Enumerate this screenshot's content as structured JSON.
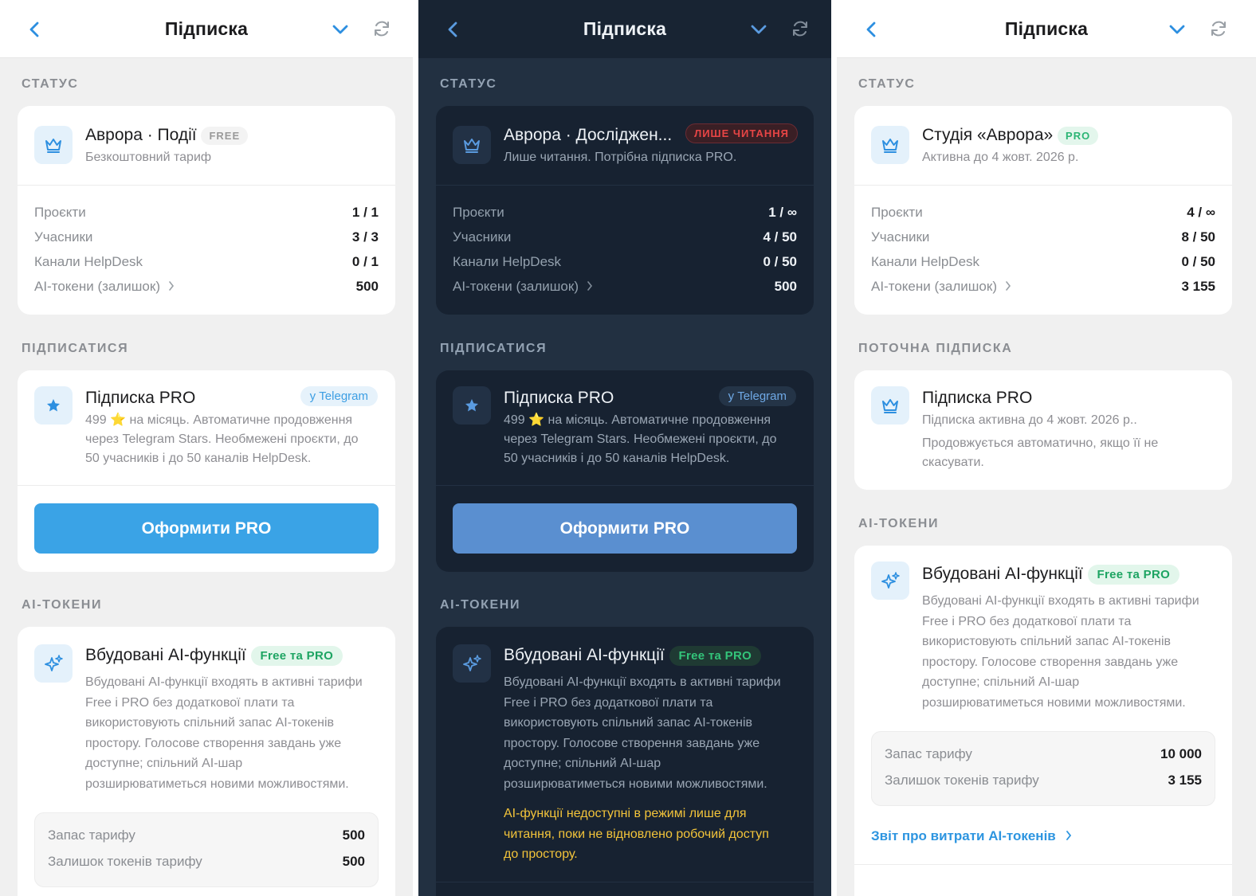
{
  "screens": [
    {
      "theme": "light",
      "header": {
        "title": "Підписка"
      },
      "status": {
        "section_title": "СТАТУС",
        "name": "Аврора · Події",
        "badge": "FREE",
        "subtitle": "Безкоштовний тариф",
        "rows": [
          {
            "label": "Проєкти",
            "value": "1 / 1"
          },
          {
            "label": "Учасники",
            "value": "3 / 3"
          },
          {
            "label": "Канали HelpDesk",
            "value": "0 / 1"
          },
          {
            "label": "AI-токени (залишок)",
            "value": "500"
          }
        ]
      },
      "subscribe": {
        "section_title": "ПІДПИСАТИСЯ",
        "title": "Підписка PRO",
        "badge": "у Telegram",
        "desc_1": "499 ⭐ на місяць. Автоматичне продовження",
        "desc_2": "через Telegram Stars. Необмежені проєкти, до",
        "desc_3": "50 учасників і до 50 каналів HelpDesk.",
        "button": "Оформити PRO"
      },
      "ai": {
        "section_title": "AI-ТОКЕНИ",
        "title": "Вбудовані AI-функції",
        "badge": "Free та PRO",
        "desc_1": "Вбудовані AI-функції входять в активні тарифи",
        "desc_2": "Free і PRO без додаткової плати та",
        "desc_3": "використовують спільний запас AI-токенів",
        "desc_4": "простору. Голосове створення завдань уже",
        "desc_5": "доступне; спільний AI-шар",
        "desc_6": "розширюватиметься новими можливостями.",
        "rows": [
          {
            "label": "Запас тарифу",
            "value": "500"
          },
          {
            "label": "Залишок токенів тарифу",
            "value": "500"
          }
        ]
      }
    },
    {
      "theme": "dark",
      "header": {
        "title": "Підписка"
      },
      "status": {
        "section_title": "СТАТУС",
        "name": "Аврора · Дослiджен...",
        "badge": "ЛИШЕ ЧИТАННЯ",
        "subtitle": "Лише читання. Потрібна підписка PRO.",
        "rows": [
          {
            "label": "Проєкти",
            "value": "1 / ∞"
          },
          {
            "label": "Учасники",
            "value": "4 / 50"
          },
          {
            "label": "Канали HelpDesk",
            "value": "0 / 50"
          },
          {
            "label": "AI-токени (залишок)",
            "value": "500"
          }
        ]
      },
      "subscribe": {
        "section_title": "ПІДПИСАТИСЯ",
        "title": "Підписка PRO",
        "badge": "у Telegram",
        "desc_1": "499 ⭐ на місяць. Автоматичне продовження",
        "desc_2": "через Telegram Stars. Необмежені проєкти, до",
        "desc_3": "50 учасників і до 50 каналів HelpDesk.",
        "button": "Оформити PRO"
      },
      "ai": {
        "section_title": "AI-ТОКЕНИ",
        "title": "Вбудовані AI-функції",
        "badge": "Free та PRO",
        "desc_1": "Вбудовані AI-функції входять в активні тарифи",
        "desc_2": "Free і PRO без додаткової плати та",
        "desc_3": "використовують спільний запас AI-токенів",
        "desc_4": "простору. Голосове створення завдань уже",
        "desc_5": "доступне; спільний AI-шар",
        "desc_6": "розширюватиметься новими можливостями.",
        "warn_1": "AI-функції недоступні в режимі лише для",
        "warn_2": "читання, поки не відновлено робочий доступ",
        "warn_3": "до простору."
      }
    },
    {
      "theme": "light",
      "header": {
        "title": "Підписка"
      },
      "status": {
        "section_title": "СТАТУС",
        "name": "Студія «Аврора»",
        "badge": "PRO",
        "subtitle": "Активна до 4 жовт. 2026 р.",
        "rows": [
          {
            "label": "Проєкти",
            "value": "4 / ∞"
          },
          {
            "label": "Учасники",
            "value": "8 / 50"
          },
          {
            "label": "Канали HelpDesk",
            "value": "0 / 50"
          },
          {
            "label": "AI-токени (залишок)",
            "value": "3 155"
          }
        ]
      },
      "current": {
        "section_title": "ПОТОЧНА ПІДПИСКА",
        "title": "Підписка PRO",
        "line_1": "Підписка активна до 4 жовт. 2026 р..",
        "line_2": "Продовжується автоматично, якщо її не",
        "line_3": "скасувати."
      },
      "ai": {
        "section_title": "AI-ТОКЕНИ",
        "title": "Вбудовані AI-функції",
        "badge": "Free та PRO",
        "desc_1": "Вбудовані AI-функції входять в активні тарифи",
        "desc_2": "Free і PRO без додаткової плати та",
        "desc_3": "використовують спільний запас AI-токенів",
        "desc_4": "простору. Голосове створення завдань уже",
        "desc_5": "доступне; спільний AI-шар",
        "desc_6": "розширюватиметься новими можливостями.",
        "rows": [
          {
            "label": "Запас тарифу",
            "value": "10 000"
          },
          {
            "label": "Залишок токенів тарифу",
            "value": "3 155"
          }
        ],
        "link": "Звіт про витрати AI-токенів"
      }
    }
  ],
  "icons": {
    "back": "chevron-left-icon",
    "expand": "chevron-down-icon",
    "refresh": "refresh-icon",
    "plan": "crown-icon",
    "subscribe": "star-icon",
    "ai": "sparkles-icon",
    "row_more": "chevron-right-icon"
  },
  "colors": {
    "accent_light": "#3aa3e6",
    "accent_dark": "#5a8fd0",
    "pro_green": "#2bb574",
    "readonly_red": "#e84545",
    "warning_yellow": "#f3c43a"
  }
}
